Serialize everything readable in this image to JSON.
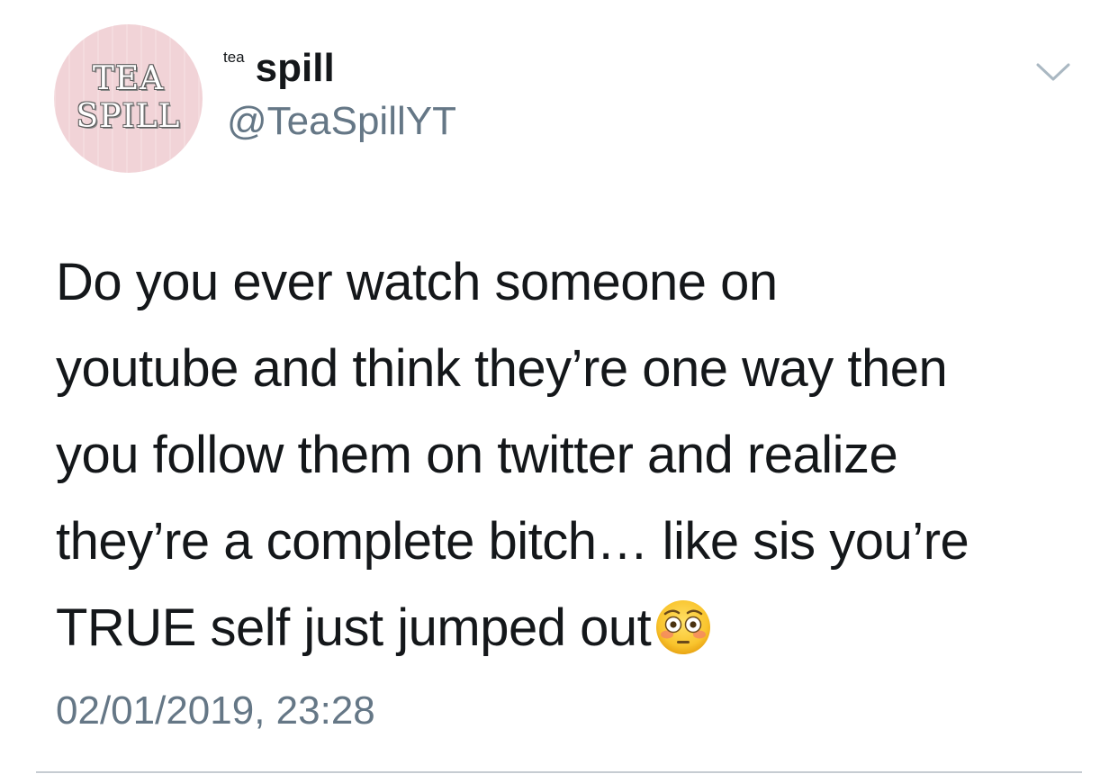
{
  "author": {
    "avatar_line1": "TEA",
    "avatar_line2": "SPILL",
    "name_prefix": "tea",
    "display_name": "spill",
    "handle": "@TeaSpillYT"
  },
  "tweet": {
    "line1": "Do you ever watch someone on",
    "line2": "youtube and think they’re one way then",
    "line3": "you follow them on twitter and realize",
    "line4": "they’re a complete bitch… like sis you’re",
    "line5": "TRUE self just jumped out",
    "emoji": "flushed-face-icon",
    "timestamp": "02/01/2019, 23:28"
  },
  "icons": {
    "menu": "chevron-down-icon"
  },
  "colors": {
    "text": "#14171a",
    "secondary": "#657786",
    "avatar_bg": "#f1d3d7",
    "divider": "#c6ccd2"
  }
}
